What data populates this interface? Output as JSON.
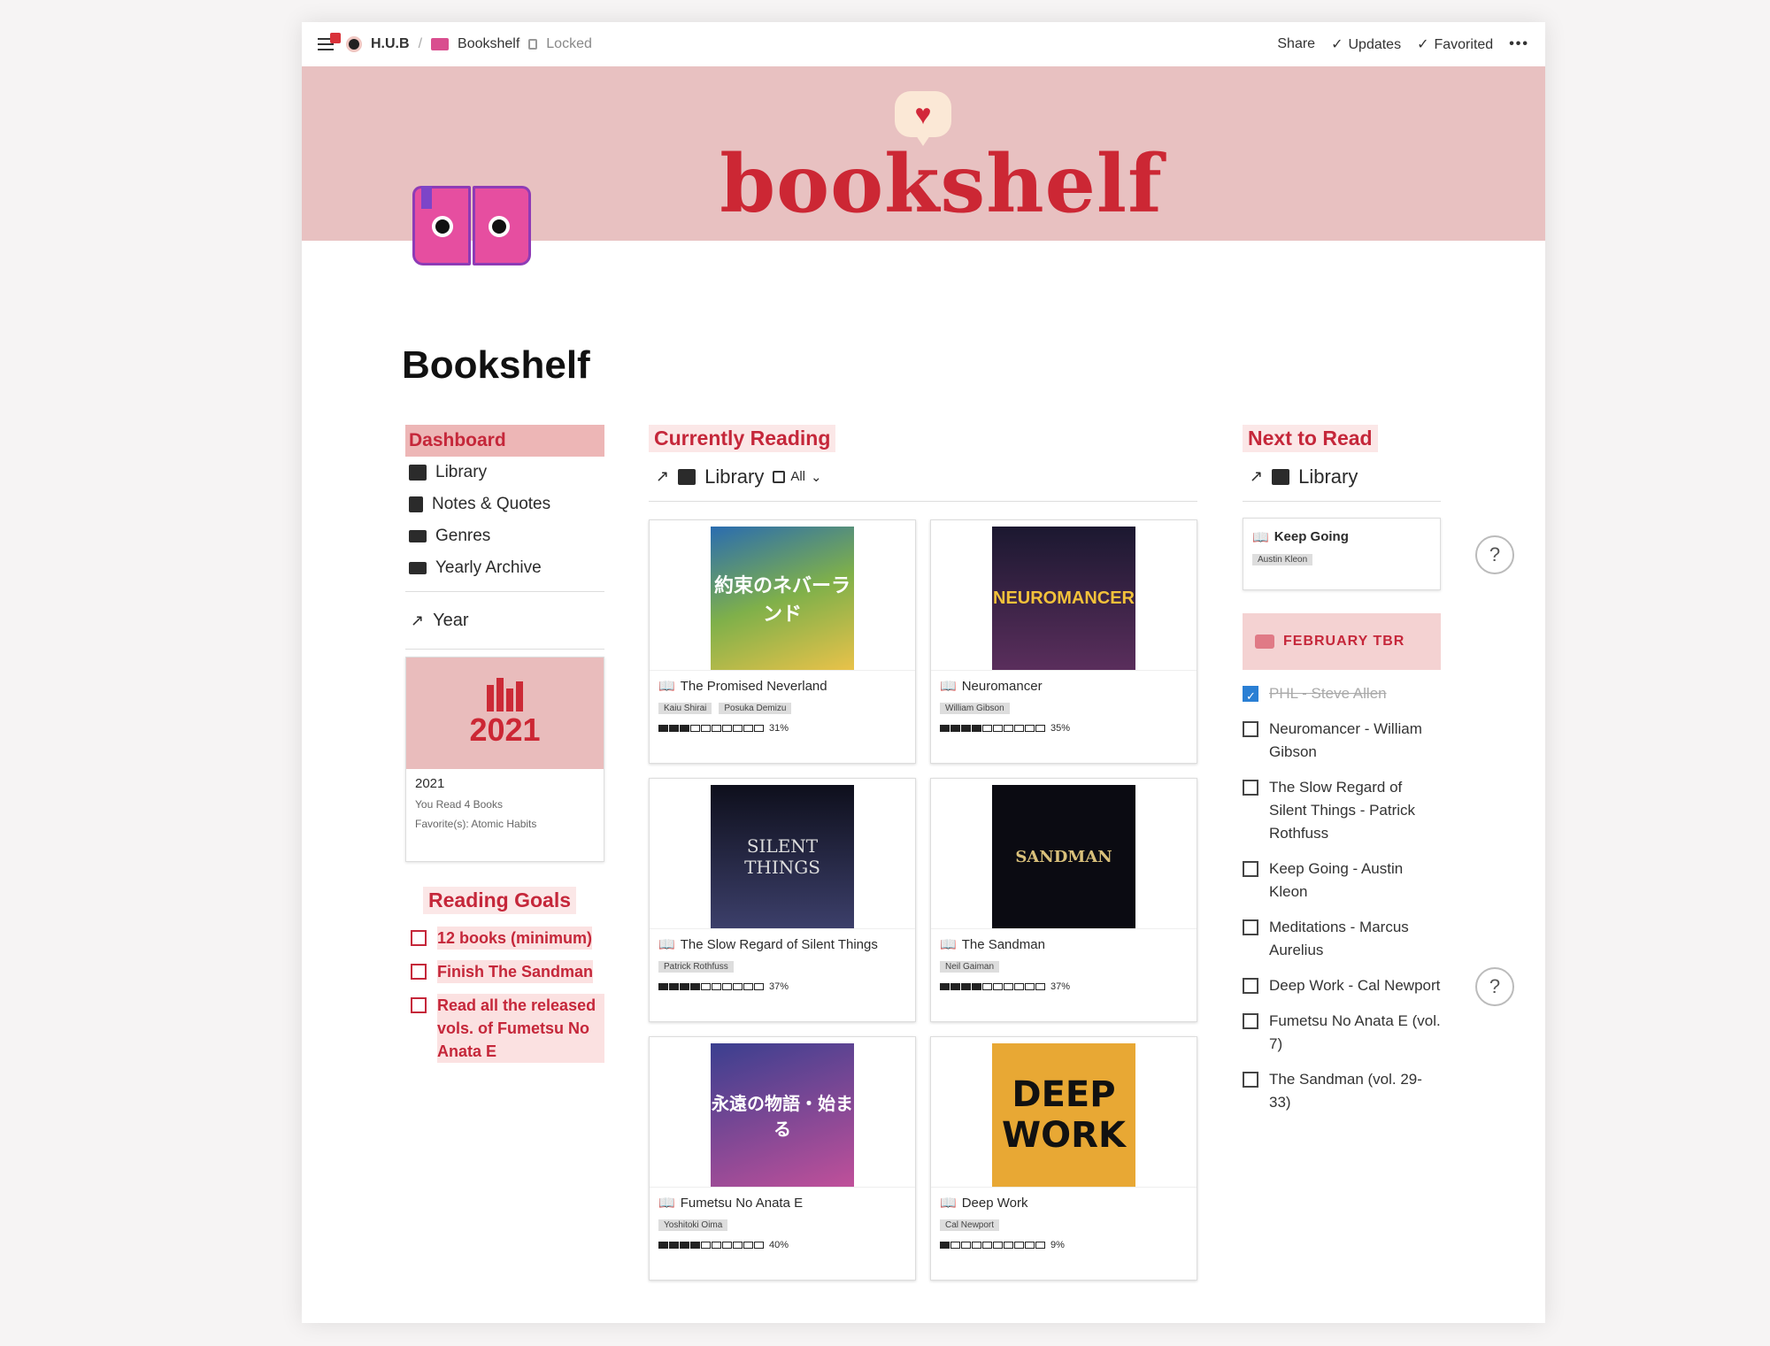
{
  "topbar": {
    "workspace": "H.U.B",
    "separator": "/",
    "page": "Bookshelf",
    "locked": "Locked",
    "share": "Share",
    "updates": "Updates",
    "favorited": "Favorited",
    "more": "•••"
  },
  "banner": {
    "title": "bookshelf"
  },
  "page_title": "Bookshelf",
  "nav": {
    "items": [
      {
        "label": "Dashboard",
        "icon": "none"
      },
      {
        "label": "Library",
        "icon": "books-icon"
      },
      {
        "label": "Notes & Quotes",
        "icon": "bookmark-icon"
      },
      {
        "label": "Genres",
        "icon": "list-icon"
      },
      {
        "label": "Yearly Archive",
        "icon": "keyboard-icon"
      }
    ],
    "year_link": "Year"
  },
  "year_card": {
    "year_cover": "2021",
    "title": "2021",
    "line1": "You Read 4 Books",
    "line2": "Favorite(s): Atomic Habits"
  },
  "goals": {
    "title": "Reading Goals",
    "items": [
      "12 books (minimum)",
      "Finish The Sandman",
      "Read all the released vols. of Fumetsu No Anata E"
    ]
  },
  "currently": {
    "title": "Currently Reading",
    "view": "Library",
    "filter": "All",
    "cards": [
      {
        "title": "The Promised Neverland",
        "tags": [
          "Kaiu Shirai",
          "Posuka Demizu"
        ],
        "progress": 31,
        "progress_label": "31%",
        "cover_text": "約束のネバーランド"
      },
      {
        "title": "Neuromancer",
        "tags": [
          "William Gibson"
        ],
        "progress": 35,
        "progress_label": "35%",
        "cover_text": "NEUROMANCER"
      },
      {
        "title": "The Slow Regard of Silent Things",
        "tags": [
          "Patrick Rothfuss"
        ],
        "progress": 37,
        "progress_label": "37%",
        "cover_text": "SILENT THINGS"
      },
      {
        "title": "The Sandman",
        "tags": [
          "Neil Gaiman"
        ],
        "progress": 37,
        "progress_label": "37%",
        "cover_text": "SANDMAN"
      },
      {
        "title": "Fumetsu No Anata E",
        "tags": [
          "Yoshitoki Oima"
        ],
        "progress": 40,
        "progress_label": "40%",
        "cover_text": "永遠の物語・始まる"
      },
      {
        "title": "Deep Work",
        "tags": [
          "Cal Newport"
        ],
        "progress": 9,
        "progress_label": "9%",
        "cover_text": "DEEP WORK"
      }
    ]
  },
  "next": {
    "title": "Next to Read",
    "view": "Library",
    "card_title": "Keep Going",
    "card_tag": "Austin Kleon",
    "tbr_title": "FEBRUARY TBR",
    "tbr": [
      {
        "label": "PHL - Steve Allen",
        "checked": true
      },
      {
        "label": "Neuromancer - William Gibson",
        "checked": false
      },
      {
        "label": "The Slow Regard of Silent Things - Patrick Rothfuss",
        "checked": false
      },
      {
        "label": "Keep Going - Austin Kleon",
        "checked": false
      },
      {
        "label": "Meditations - Marcus Aurelius",
        "checked": false
      },
      {
        "label": "Deep Work - Cal Newport",
        "checked": false
      },
      {
        "label": "Fumetsu No Anata E (vol. 7)",
        "checked": false
      },
      {
        "label": "The Sandman (vol. 29-33)",
        "checked": false
      }
    ]
  },
  "help": "?",
  "colors": {
    "accent": "#c5273a",
    "banner": "#e8c1c1",
    "check": "#2a7fd4"
  }
}
